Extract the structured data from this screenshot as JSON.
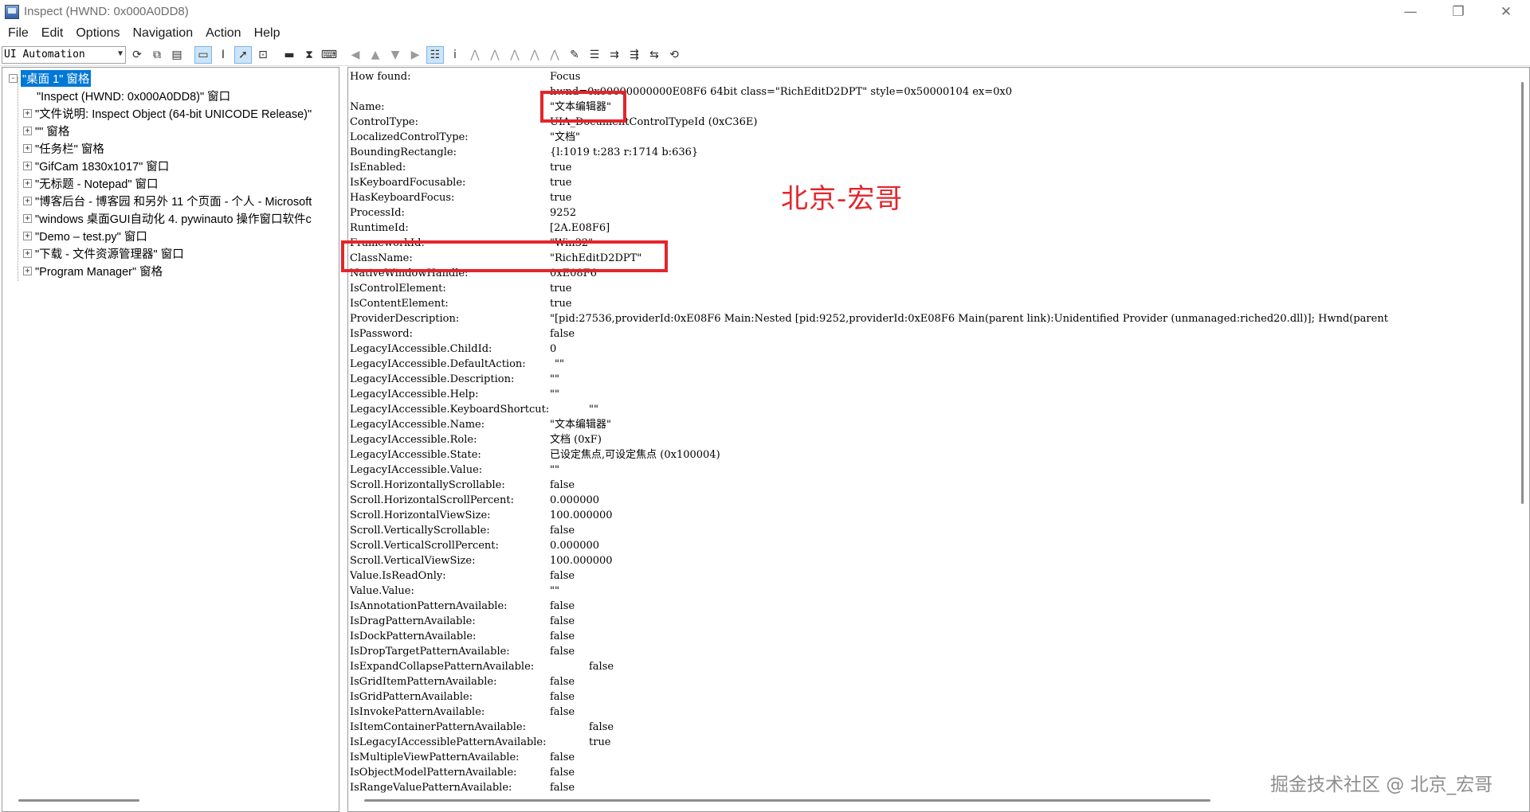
{
  "window": {
    "title": "Inspect  (HWND: 0x000A0DD8)",
    "minimize_glyph": "—",
    "maximize_glyph": "❐",
    "close_glyph": "✕"
  },
  "menu": [
    "File",
    "Edit",
    "Options",
    "Navigation",
    "Action",
    "Help"
  ],
  "toolbar": {
    "mode_select_value": "UI Automation",
    "icons": [
      "refresh-icon",
      "copy-icon",
      "tree-copy-icon",
      "highlight-rect-icon",
      "caret-icon",
      "pointer-icon",
      "focus-icon",
      "show-rect-icon",
      "hourglass-icon",
      "keyboard-icon",
      "nav-back-icon",
      "nav-up-icon",
      "nav-down-icon",
      "nav-forward-icon",
      "tree-view-icon",
      "info-icon",
      "parent-icon",
      "first-child-icon",
      "next-sibling-icon",
      "prev-sibling-icon",
      "last-child-icon",
      "pattern-icon",
      "properties-icon",
      "settings-icon",
      "expand-icon",
      "collapse-icon",
      "refresh-tree-icon"
    ]
  },
  "tree": [
    {
      "label": "\"桌面 1\" 窗格",
      "expander": "-",
      "selected": true,
      "level": 0
    },
    {
      "label": "\"Inspect  (HWND: 0x000A0DD8)\" 窗口",
      "expander": "",
      "selected": false,
      "level": 1
    },
    {
      "label": "\"文件说明: Inspect Object (64-bit UNICODE Release)\"",
      "expander": "+",
      "selected": false,
      "level": 1
    },
    {
      "label": "\"\" 窗格",
      "expander": "+",
      "selected": false,
      "level": 1
    },
    {
      "label": "\"任务栏\" 窗格",
      "expander": "+",
      "selected": false,
      "level": 1
    },
    {
      "label": "\"GifCam 1830x1017\" 窗口",
      "expander": "+",
      "selected": false,
      "level": 1
    },
    {
      "label": "\"无标题 - Notepad\" 窗口",
      "expander": "+",
      "selected": false,
      "level": 1
    },
    {
      "label": "\"博客后台 - 博客园 和另外 11 个页面 - 个人 - Microsoft",
      "expander": "+",
      "selected": false,
      "level": 1
    },
    {
      "label": "\"windows 桌面GUI自动化 4. pywinauto 操作窗口软件c",
      "expander": "+",
      "selected": false,
      "level": 1
    },
    {
      "label": "\"Demo – test.py\" 窗口",
      "expander": "+",
      "selected": false,
      "level": 1
    },
    {
      "label": "\"下载 - 文件资源管理器\" 窗口",
      "expander": "+",
      "selected": false,
      "level": 1
    },
    {
      "label": "\"Program Manager\" 窗格",
      "expander": "+",
      "selected": false,
      "level": 1
    }
  ],
  "properties": [
    {
      "k": "How found:",
      "v": "Focus"
    },
    {
      "k": "",
      "v": "hwnd=0x00000000000E08F6 64bit class=\"RichEditD2DPT\" style=0x50000104 ex=0x0"
    },
    {
      "k": "Name:",
      "v": "\"文本编辑器\""
    },
    {
      "k": "ControlType:",
      "v": "UIA_DocumentControlTypeId (0xC36E)"
    },
    {
      "k": "LocalizedControlType:",
      "v": "\"文档\""
    },
    {
      "k": "BoundingRectangle:",
      "v": "{l:1019 t:283 r:1714 b:636}"
    },
    {
      "k": "IsEnabled:",
      "v": "true"
    },
    {
      "k": "IsKeyboardFocusable:",
      "v": "true"
    },
    {
      "k": "HasKeyboardFocus:",
      "v": "true"
    },
    {
      "k": "ProcessId:",
      "v": "9252"
    },
    {
      "k": "RuntimeId:",
      "v": "[2A.E08F6]"
    },
    {
      "k": "FrameworkId:",
      "v": "\"Win32\""
    },
    {
      "k": "ClassName:",
      "v": "\"RichEditD2DPT\""
    },
    {
      "k": "NativeWindowHandle:",
      "v": "0xE08F6"
    },
    {
      "k": "IsControlElement:",
      "v": "true"
    },
    {
      "k": "IsContentElement:",
      "v": "true"
    },
    {
      "k": "ProviderDescription:",
      "v": "\"[pid:27536,providerId:0xE08F6 Main:Nested [pid:9252,providerId:0xE08F6 Main(parent link):Unidentified Provider (unmanaged:riched20.dll)]; Hwnd(parent"
    },
    {
      "k": "IsPassword:",
      "v": "false"
    },
    {
      "k": "LegacyIAccessible.ChildId:",
      "v": "0"
    },
    {
      "k": "LegacyIAccessible.DefaultAction:",
      "v": "\"\"",
      "wide": "mid"
    },
    {
      "k": "LegacyIAccessible.Description:",
      "v": "\"\""
    },
    {
      "k": "LegacyIAccessible.Help:",
      "v": "\"\""
    },
    {
      "k": "LegacyIAccessible.KeyboardShortcut:",
      "v": "\"\"",
      "wide": "long"
    },
    {
      "k": "LegacyIAccessible.Name:",
      "v": "\"文本编辑器\""
    },
    {
      "k": "LegacyIAccessible.Role:",
      "v": "文档 (0xF)"
    },
    {
      "k": "LegacyIAccessible.State:",
      "v": "已设定焦点,可设定焦点 (0x100004)"
    },
    {
      "k": "LegacyIAccessible.Value:",
      "v": "\"\""
    },
    {
      "k": "Scroll.HorizontallyScrollable:",
      "v": "false"
    },
    {
      "k": "Scroll.HorizontalScrollPercent:",
      "v": "0.000000"
    },
    {
      "k": "Scroll.HorizontalViewSize:",
      "v": "100.000000"
    },
    {
      "k": "Scroll.VerticallyScrollable:",
      "v": "false"
    },
    {
      "k": "Scroll.VerticalScrollPercent:",
      "v": "0.000000"
    },
    {
      "k": "Scroll.VerticalViewSize:",
      "v": "100.000000"
    },
    {
      "k": "Value.IsReadOnly:",
      "v": "false"
    },
    {
      "k": "Value.Value:",
      "v": "\"\""
    },
    {
      "k": "IsAnnotationPatternAvailable:",
      "v": "false"
    },
    {
      "k": "IsDragPatternAvailable:",
      "v": "false"
    },
    {
      "k": "IsDockPatternAvailable:",
      "v": "false"
    },
    {
      "k": "IsDropTargetPatternAvailable:",
      "v": "false"
    },
    {
      "k": "IsExpandCollapsePatternAvailable:",
      "v": "false",
      "wide": "long"
    },
    {
      "k": "IsGridItemPatternAvailable:",
      "v": "false"
    },
    {
      "k": "IsGridPatternAvailable:",
      "v": "false"
    },
    {
      "k": "IsInvokePatternAvailable:",
      "v": "false"
    },
    {
      "k": "IsItemContainerPatternAvailable:",
      "v": "false",
      "wide": "long"
    },
    {
      "k": "IsLegacyIAccessiblePatternAvailable:",
      "v": "true",
      "wide": "long"
    },
    {
      "k": "IsMultipleViewPatternAvailable:",
      "v": "false"
    },
    {
      "k": "IsObjectModelPatternAvailable:",
      "v": "false"
    },
    {
      "k": "IsRangeValuePatternAvailable:",
      "v": "false"
    }
  ],
  "annotations": {
    "watermark_red": "北京-宏哥",
    "watermark_gray": "掘金技术社区 @ 北京_宏哥"
  },
  "colors": {
    "accent": "#0078d7",
    "highlight": "#e2262b"
  }
}
